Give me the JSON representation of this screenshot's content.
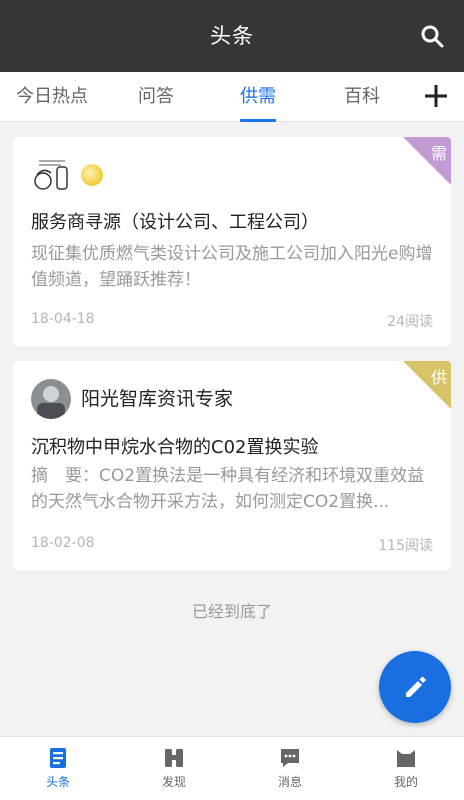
{
  "header": {
    "title": "头条",
    "search_icon": "search-icon"
  },
  "tabs": [
    {
      "label": "今日热点",
      "active": false
    },
    {
      "label": "问答",
      "active": false
    },
    {
      "label": "供需",
      "active": true
    },
    {
      "label": "百科",
      "active": false
    }
  ],
  "tab_add_icon": "plus-icon",
  "cards": [
    {
      "tag": "需",
      "tag_color": "#c39bd3",
      "author": "",
      "title": "服务商寻源（设计公司、工程公司）",
      "summary": "现征集优质燃气类设计公司及施工公司加入阳光e购增值频道，望踊跃推荐！",
      "date": "18-04-18",
      "reads": "24阅读"
    },
    {
      "tag": "供",
      "tag_color": "#d8c468",
      "author": "阳光智库资讯专家",
      "title": "沉积物中甲烷水合物的C02置换实验",
      "summary": "摘　要：CO2置换法是一种具有经济和环境双重效益的天然气水合物开采方法，如何测定CO2置换...",
      "date": "18-02-08",
      "reads": "115阅读"
    }
  ],
  "end_text": "已经到底了",
  "fab_icon": "pencil-icon",
  "bottom_nav": [
    {
      "label": "头条",
      "icon": "news-icon",
      "active": true
    },
    {
      "label": "发现",
      "icon": "binoculars-icon",
      "active": false
    },
    {
      "label": "消息",
      "icon": "chat-icon",
      "active": false
    },
    {
      "label": "我的",
      "icon": "profile-icon",
      "active": false
    }
  ],
  "colors": {
    "accent": "#1a73e8",
    "header_bg": "#363636"
  }
}
